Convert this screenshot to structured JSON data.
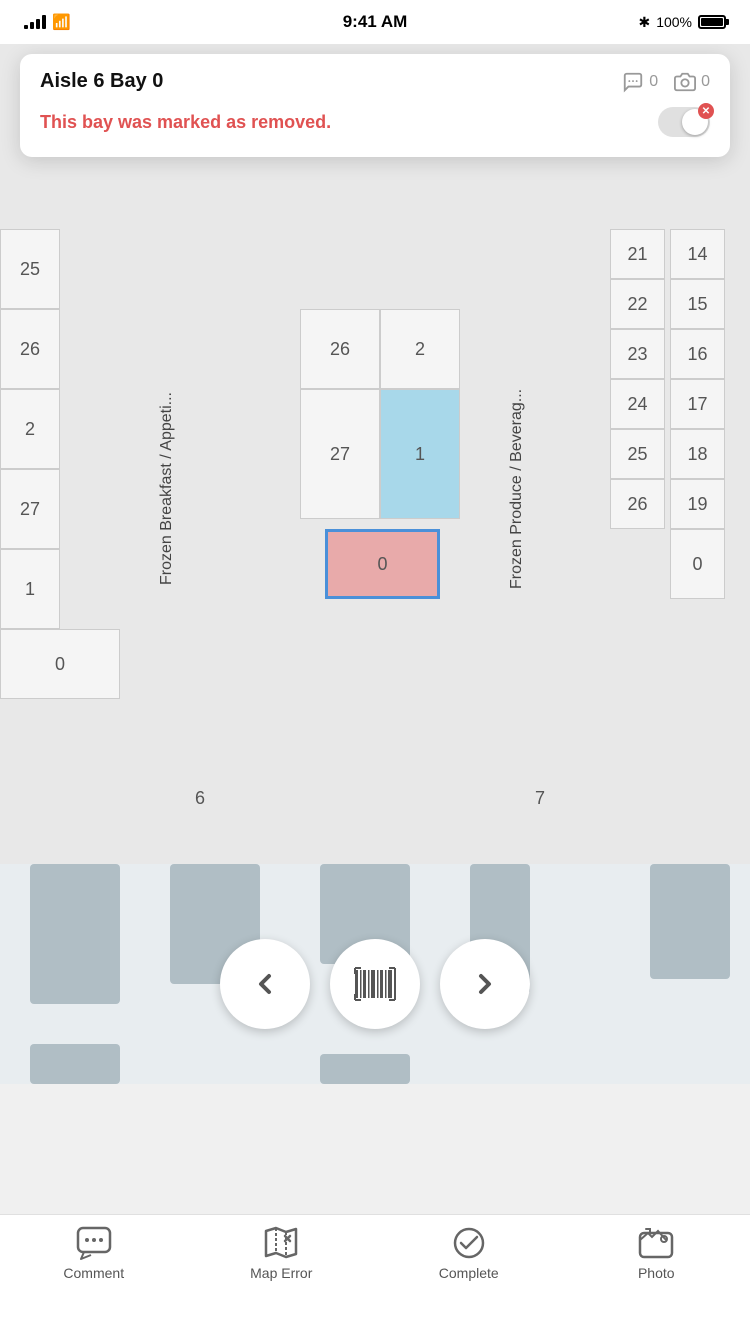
{
  "statusBar": {
    "time": "9:41 AM",
    "battery": "100%",
    "bluetooth": "BT"
  },
  "popup": {
    "title": "Aisle 6 Bay 0",
    "comments_count": "0",
    "photos_count": "0",
    "removed_message": "This bay was marked as removed."
  },
  "grid": {
    "aisle6_label": "6",
    "aisle7_label": "7",
    "frozen_breakfast_label": "Frozen Breakfast / Appeti...",
    "frozen_produce_label": "Frozen Produce / Beverag...",
    "cells_left": [
      {
        "row": 1,
        "col": 1,
        "val": "26",
        "type": "normal"
      },
      {
        "row": 1,
        "col": 2,
        "val": "2",
        "type": "normal"
      },
      {
        "row": 2,
        "col": 1,
        "val": "27",
        "type": "normal"
      },
      {
        "row": 2,
        "col": 2,
        "val": "1",
        "type": "blue"
      },
      {
        "row": 3,
        "col": 1,
        "val": "0",
        "type": "pink-selected"
      }
    ],
    "cells_right": [
      {
        "val": "21"
      },
      {
        "val": "14"
      },
      {
        "val": "22"
      },
      {
        "val": "15"
      },
      {
        "val": "23"
      },
      {
        "val": "16"
      },
      {
        "val": "24"
      },
      {
        "val": "17"
      },
      {
        "val": "25"
      },
      {
        "val": "18"
      },
      {
        "val": "26"
      },
      {
        "val": "19"
      },
      {
        "val": "0"
      }
    ]
  },
  "nav": {
    "prev_label": "◀",
    "next_label": "▶"
  },
  "tabs": [
    {
      "id": "comment",
      "label": "Comment"
    },
    {
      "id": "map-error",
      "label": "Map Error"
    },
    {
      "id": "complete",
      "label": "Complete"
    },
    {
      "id": "photo",
      "label": "Photo"
    }
  ]
}
